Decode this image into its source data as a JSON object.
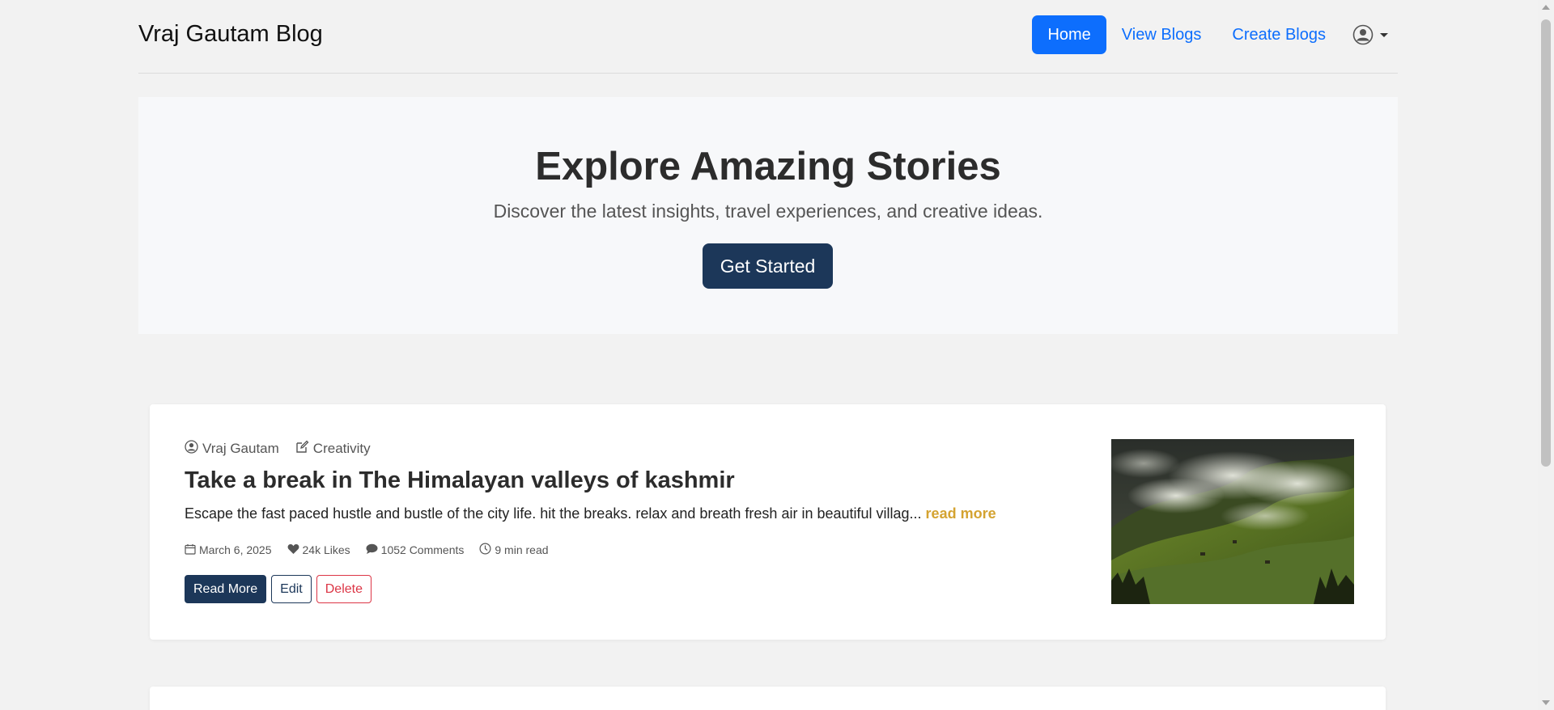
{
  "navbar": {
    "brand": "Vraj Gautam Blog",
    "links": [
      {
        "label": "Home",
        "active": true
      },
      {
        "label": "View Blogs",
        "active": false
      },
      {
        "label": "Create Blogs",
        "active": false
      }
    ],
    "profile_icon": "user-circle-icon"
  },
  "hero": {
    "title": "Explore Amazing Stories",
    "subtitle": "Discover the latest insights, travel experiences, and creative ideas.",
    "cta_label": "Get Started"
  },
  "posts": [
    {
      "author": "Vraj Gautam",
      "category": "Creativity",
      "title": "Take a break in The Himalayan valleys of kashmir",
      "excerpt": "Escape the fast paced hustle and bustle of the city life. hit the breaks. relax and breath fresh air in beautiful villag...",
      "read_more_link": "read more",
      "date": "March 6, 2025",
      "likes": "24k Likes",
      "comments": "1052 Comments",
      "read_time": "9 min read",
      "buttons": {
        "read_more": "Read More",
        "edit": "Edit",
        "delete": "Delete"
      },
      "image": "misty-mountain-valley-photo"
    }
  ],
  "colors": {
    "primary": "#0d6efd",
    "navy": "#1c3759",
    "gold": "#d4a331",
    "danger": "#dc3545",
    "page_bg": "#f2f2f2"
  }
}
